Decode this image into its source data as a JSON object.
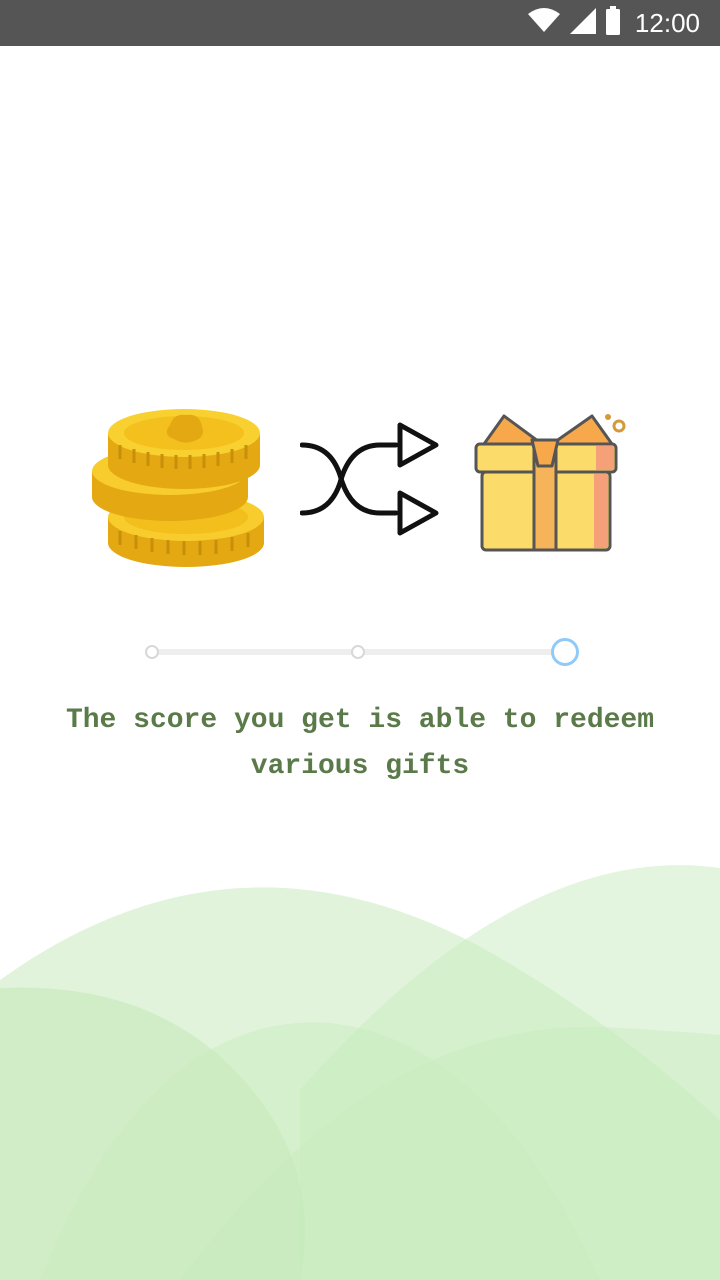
{
  "status_bar": {
    "time": "12:00",
    "icons": [
      "wifi-icon",
      "cellular-signal-icon",
      "battery-icon"
    ]
  },
  "illustration": {
    "icons": [
      "coin-stack-icon",
      "shuffle-arrows-icon",
      "gift-box-icon"
    ]
  },
  "pager": {
    "total_pages": 3,
    "current_page": 3
  },
  "caption": {
    "line1": "The score you get is able to redeem",
    "line2": "various gifts"
  },
  "colors": {
    "status_bar": "#555555",
    "caption_text": "#5b7a4a",
    "active_dot": "#90caf9",
    "hills": "#c8ebbd",
    "coin": "#f2c01e",
    "gift": "#fbdc6a"
  }
}
